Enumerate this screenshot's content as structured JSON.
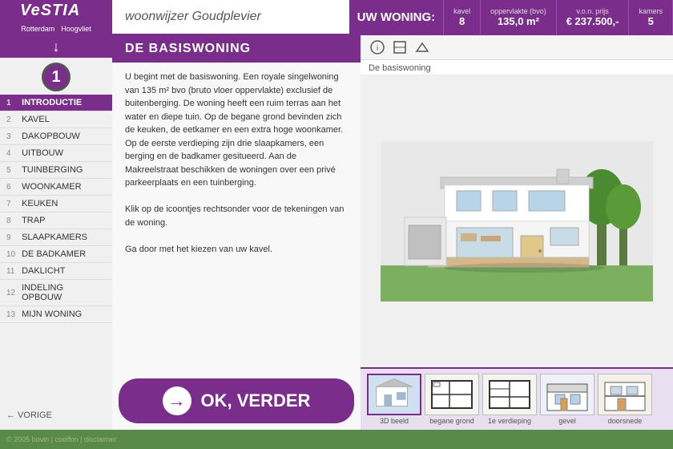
{
  "header": {
    "logo": "VeSTIA",
    "logo_sub1": "Rotterdam",
    "logo_sub2": "Hoogvliet",
    "title": "woonwijzer Goudplevier"
  },
  "uw_woning": {
    "label": "UW WONING:",
    "kavel_label": "kavel",
    "kavel_value": "8",
    "oppervlakte_label": "oppervlakte (bvo)",
    "oppervlakte_value": "135,0 m²",
    "prijs_label": "v.o.n. prijs",
    "prijs_value": "€ 237.500,-",
    "kamers_label": "kamers",
    "kamers_value": "5"
  },
  "sidebar": {
    "nav_arrow": "↓",
    "step": "1",
    "items": [
      {
        "num": "1",
        "label": "INTRODUCTIE",
        "active": true
      },
      {
        "num": "2",
        "label": "KAVEL",
        "active": false
      },
      {
        "num": "3",
        "label": "DAKOPBOUW",
        "active": false
      },
      {
        "num": "4",
        "label": "UITBOUW",
        "active": false
      },
      {
        "num": "5",
        "label": "TUINBERGING",
        "active": false
      },
      {
        "num": "6",
        "label": "WOONKAMER",
        "active": false
      },
      {
        "num": "7",
        "label": "KEUKEN",
        "active": false
      },
      {
        "num": "8",
        "label": "TRAP",
        "active": false
      },
      {
        "num": "9",
        "label": "SLAAPKAMERS",
        "active": false
      },
      {
        "num": "10",
        "label": "DE BADKAMER",
        "active": false
      },
      {
        "num": "11",
        "label": "DAKLICHT",
        "active": false
      },
      {
        "num": "12",
        "label": "INDELING OPBOUW",
        "active": false
      },
      {
        "num": "13",
        "label": "MIJN WONING",
        "active": false
      }
    ],
    "vorige": "← VORIGE"
  },
  "content": {
    "title": "DE BASISWONING",
    "body": "U begint met de basiswoning. Een royale singelwoning van 135 m² bvo (bruto vloer oppervlakte) exclusief de buitenberging. De woning heeft een ruim terras aan het water en diepe tuin. Op de begane grond bevinden zich de keuken, de eetkamer en een extra hoge woonkamer. Op de eerste verdieping zijn drie slaapkamers, een berging en de badkamer gesitueerd. Aan de Makreelstraat beschikken de woningen over een privé parkeerplaats en een tuinberging.\n\nKlik op de icoontjes rechtsonder voor de tekeningen van de woning.\n\nGa door met het kiezen van uw  kavel.",
    "ok_verder": "OK, VERDER"
  },
  "right_panel": {
    "label": "De basiswoning",
    "thumbnails": [
      {
        "label": "3D beeld",
        "active": true
      },
      {
        "label": "begane grond",
        "active": false
      },
      {
        "label": "1e verdieping",
        "active": false
      },
      {
        "label": "gevel",
        "active": false
      },
      {
        "label": "doorsnede",
        "active": false
      }
    ]
  },
  "footer": {
    "text": "© 2005 bovin | coolfon | disclaimer"
  }
}
